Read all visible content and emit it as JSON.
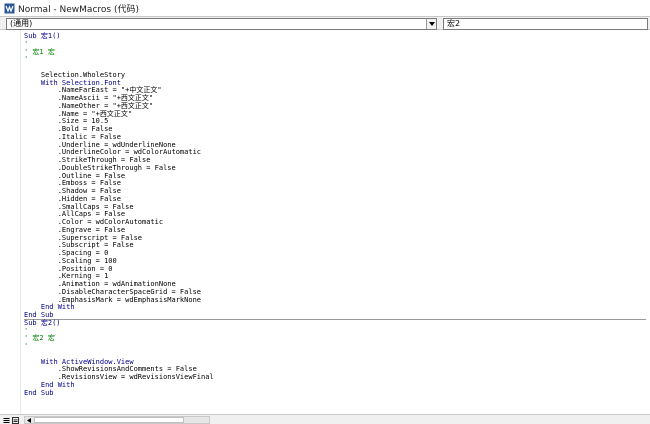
{
  "window": {
    "title": "Normal - NewMacros (代码)",
    "icon": "vba-editor-icon"
  },
  "object_dropdown": {
    "value": "(通用)",
    "icon": "chevron-down-icon"
  },
  "procedure_dropdown": {
    "value": "宏2"
  },
  "code_lines": [
    {
      "text": "Sub 宏1()",
      "kind": "kw",
      "sep": false
    },
    {
      "text": "'",
      "kind": "cm",
      "sep": false
    },
    {
      "text": "' 宏1 宏",
      "kind": "cm",
      "sep": false
    },
    {
      "text": "'",
      "kind": "cm",
      "sep": false
    },
    {
      "text": "",
      "kind": "tx",
      "sep": false
    },
    {
      "text": "    Selection.WholeStory",
      "kind": "tx",
      "sep": false
    },
    {
      "text": "    With Selection.Font",
      "kind": "kw",
      "sep": false
    },
    {
      "text": "        .NameFarEast = \"+中文正文\"",
      "kind": "tx",
      "sep": false
    },
    {
      "text": "        .NameAscii = \"+西文正文\"",
      "kind": "tx",
      "sep": false
    },
    {
      "text": "        .NameOther = \"+西文正文\"",
      "kind": "tx",
      "sep": false
    },
    {
      "text": "        .Name = \"+西文正文\"",
      "kind": "tx",
      "sep": false
    },
    {
      "text": "        .Size = 10.5",
      "kind": "tx",
      "sep": false
    },
    {
      "text": "        .Bold = False",
      "kind": "tx",
      "sep": false
    },
    {
      "text": "        .Italic = False",
      "kind": "tx",
      "sep": false
    },
    {
      "text": "        .Underline = wdUnderlineNone",
      "kind": "tx",
      "sep": false
    },
    {
      "text": "        .UnderlineColor = wdColorAutomatic",
      "kind": "tx",
      "sep": false
    },
    {
      "text": "        .StrikeThrough = False",
      "kind": "tx",
      "sep": false
    },
    {
      "text": "        .DoubleStrikeThrough = False",
      "kind": "tx",
      "sep": false
    },
    {
      "text": "        .Outline = False",
      "kind": "tx",
      "sep": false
    },
    {
      "text": "        .Emboss = False",
      "kind": "tx",
      "sep": false
    },
    {
      "text": "        .Shadow = False",
      "kind": "tx",
      "sep": false
    },
    {
      "text": "        .Hidden = False",
      "kind": "tx",
      "sep": false
    },
    {
      "text": "        .SmallCaps = False",
      "kind": "tx",
      "sep": false
    },
    {
      "text": "        .AllCaps = False",
      "kind": "tx",
      "sep": false
    },
    {
      "text": "        .Color = wdColorAutomatic",
      "kind": "tx",
      "sep": false
    },
    {
      "text": "        .Engrave = False",
      "kind": "tx",
      "sep": false
    },
    {
      "text": "        .Superscript = False",
      "kind": "tx",
      "sep": false
    },
    {
      "text": "        .Subscript = False",
      "kind": "tx",
      "sep": false
    },
    {
      "text": "        .Spacing = 0",
      "kind": "tx",
      "sep": false
    },
    {
      "text": "        .Scaling = 100",
      "kind": "tx",
      "sep": false
    },
    {
      "text": "        .Position = 0",
      "kind": "tx",
      "sep": false
    },
    {
      "text": "        .Kerning = 1",
      "kind": "tx",
      "sep": false
    },
    {
      "text": "        .Animation = wdAnimationNone",
      "kind": "tx",
      "sep": false
    },
    {
      "text": "        .DisableCharacterSpaceGrid = False",
      "kind": "tx",
      "sep": false
    },
    {
      "text": "        .EmphasisMark = wdEmphasisMarkNone",
      "kind": "tx",
      "sep": false
    },
    {
      "text": "    End With",
      "kind": "kw",
      "sep": false
    },
    {
      "text": "End Sub",
      "kind": "kw",
      "sep": true
    },
    {
      "text": "Sub 宏2()",
      "kind": "kw",
      "sep": false
    },
    {
      "text": "'",
      "kind": "cm",
      "sep": false
    },
    {
      "text": "' 宏2 宏",
      "kind": "cm",
      "sep": false
    },
    {
      "text": "'",
      "kind": "cm",
      "sep": false
    },
    {
      "text": "",
      "kind": "tx",
      "sep": false
    },
    {
      "text": "    With ActiveWindow.View",
      "kind": "kw",
      "sep": false
    },
    {
      "text": "        .ShowRevisionsAndComments = False",
      "kind": "tx",
      "sep": false
    },
    {
      "text": "        .RevisionsView = wdRevisionsViewFinal",
      "kind": "tx",
      "sep": false
    },
    {
      "text": "    End With",
      "kind": "kw",
      "sep": false
    },
    {
      "text": "End Sub",
      "kind": "kw",
      "sep": false
    }
  ],
  "colors": {
    "keyword": "#00008b",
    "comment": "#008000",
    "text": "#000000"
  },
  "statusbar": {
    "procedure_view_icon": "procedure-view-icon",
    "full_module_view_icon": "full-module-view-icon",
    "scroll_left_icon": "scroll-left-arrow-icon"
  }
}
